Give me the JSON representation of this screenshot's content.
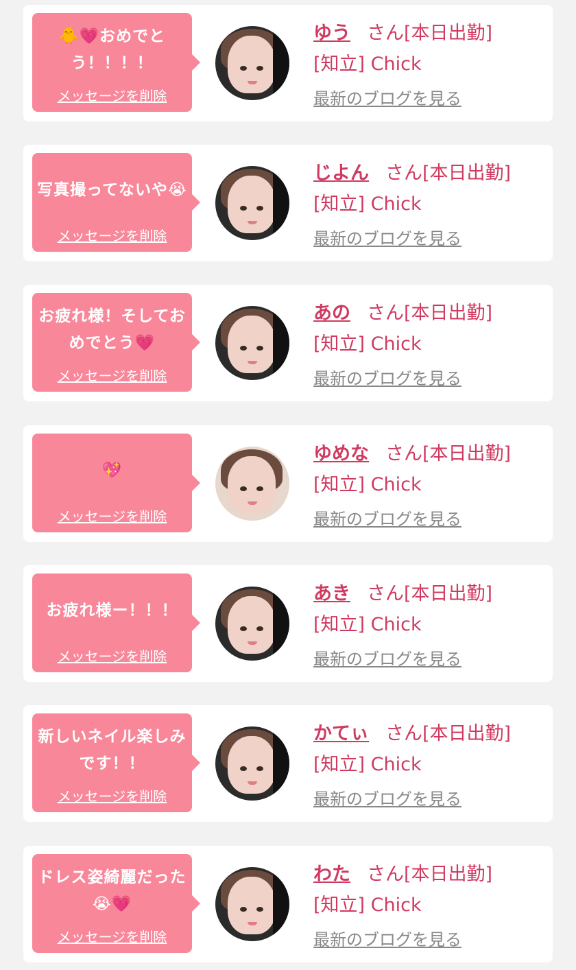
{
  "messages": [
    {
      "message": "🐥💗おめでとう！！！！",
      "delete_label": "メッセージを削除",
      "cast_name": "ゆう",
      "status": "さん[本日出勤]",
      "shop": "[知立] Chick",
      "blog_link": "最新のブログを見る",
      "avatar_icon": "cast-photo-icon"
    },
    {
      "message": "写真撮ってないや😭",
      "delete_label": "メッセージを削除",
      "cast_name": "じよん",
      "status": "さん[本日出勤]",
      "shop": "[知立] Chick",
      "blog_link": "最新のブログを見る",
      "avatar_icon": "cast-photo-icon"
    },
    {
      "message": "お疲れ様！そしておめでとう💗",
      "delete_label": "メッセージを削除",
      "cast_name": "あの",
      "status": "さん[本日出勤]",
      "shop": "[知立] Chick",
      "blog_link": "最新のブログを見る",
      "avatar_icon": "cast-photo-icon"
    },
    {
      "message": "💖",
      "delete_label": "メッセージを削除",
      "cast_name": "ゆめな",
      "status": "さん[本日出勤]",
      "shop": "[知立] Chick",
      "blog_link": "最新のブログを見る",
      "avatar_icon": "cast-photo-icon"
    },
    {
      "message": "お疲れ様ー！！！",
      "delete_label": "メッセージを削除",
      "cast_name": "あき",
      "status": "さん[本日出勤]",
      "shop": "[知立] Chick",
      "blog_link": "最新のブログを見る",
      "avatar_icon": "cast-photo-icon"
    },
    {
      "message": "新しいネイル楽しみです！！",
      "delete_label": "メッセージを削除",
      "cast_name": "かてぃ",
      "status": "さん[本日出勤]",
      "shop": "[知立] Chick",
      "blog_link": "最新のブログを見る",
      "avatar_icon": "cast-photo-icon"
    },
    {
      "message": "ドレス姿綺麗だった😭💗",
      "delete_label": "メッセージを削除",
      "cast_name": "わた",
      "status": "さん[本日出勤]",
      "shop": "[知立] Chick",
      "blog_link": "最新のブログを見る",
      "avatar_icon": "cast-photo-icon"
    }
  ],
  "colors": {
    "page_background": "#f2f2f2",
    "card_background": "#ffffff",
    "bubble": "#f9879a",
    "accent_pink": "#d03a60",
    "blog_link_gray": "#888888"
  }
}
